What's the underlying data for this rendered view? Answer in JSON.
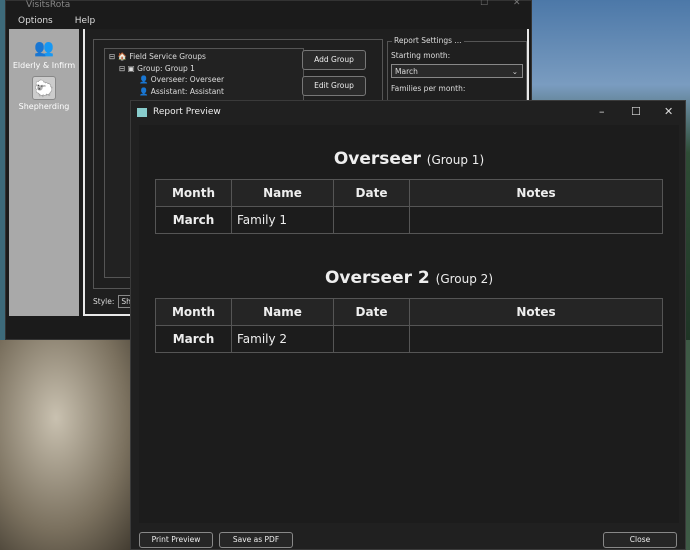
{
  "main_window": {
    "title": "VisitsRota",
    "menu": [
      "Options",
      "Help"
    ],
    "sidebar": [
      {
        "label": "Elderly & Infirm",
        "icon": "elderly-icon"
      },
      {
        "label": "Shepherding",
        "icon": "sheep-icon"
      }
    ],
    "tree": {
      "root": "Field Service Groups",
      "group": "Group: Group 1",
      "overseer": "Overseer: Overseer",
      "assistant": "Assistant: Assistant"
    },
    "buttons": {
      "add_group": "Add Group",
      "edit_group": "Edit Group"
    },
    "report_settings": {
      "legend": "Report Settings ...",
      "starting_month_label": "Starting month:",
      "starting_month": "March",
      "families_label": "Families per month:"
    },
    "style": {
      "label": "Style:",
      "value": "Shep"
    }
  },
  "dialog": {
    "title": "Report Preview",
    "columns": [
      "Month",
      "Name",
      "Date",
      "Notes"
    ],
    "sections": [
      {
        "heading": "Overseer",
        "group": "(Group 1)",
        "rows": [
          {
            "month": "March",
            "name": "Family 1",
            "date": "",
            "notes": ""
          }
        ]
      },
      {
        "heading": "Overseer 2",
        "group": "(Group 2)",
        "rows": [
          {
            "month": "March",
            "name": "Family 2",
            "date": "",
            "notes": ""
          }
        ]
      }
    ],
    "buttons": {
      "print_preview": "Print Preview",
      "save_pdf": "Save as PDF",
      "close": "Close"
    }
  }
}
